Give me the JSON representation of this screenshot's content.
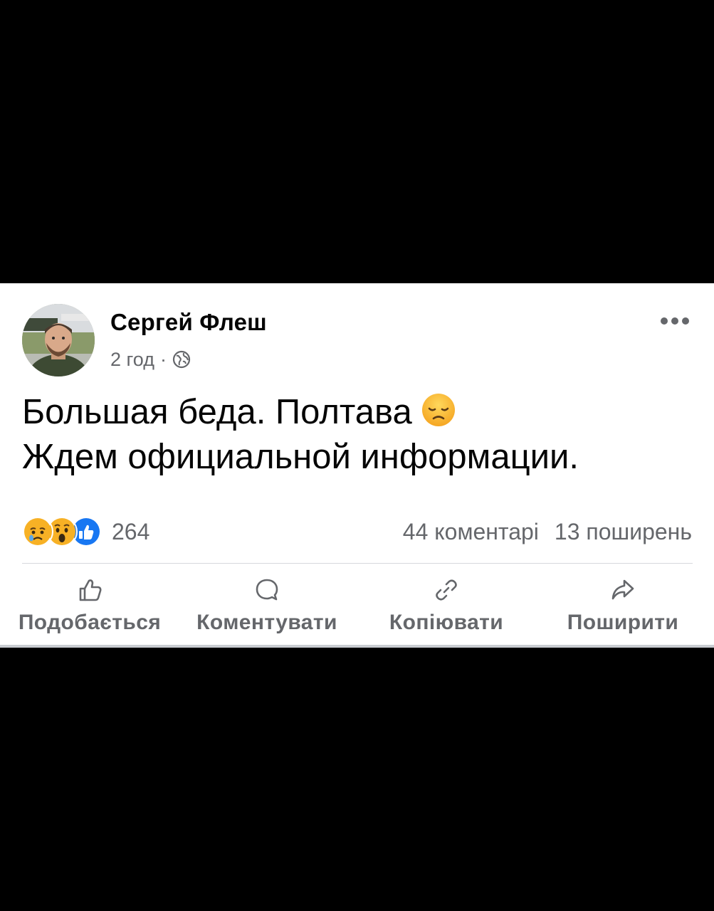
{
  "post": {
    "author_name": "Сергей Флеш",
    "timestamp": "2 год",
    "meta_separator": "·",
    "privacy_icon": "globe-icon",
    "more_icon": "more-options-icon",
    "text_line_1": "Большая беда. Полтава",
    "text_line_2": "Ждем официальной информации.",
    "inline_emoji": "disappointed-face-emoji"
  },
  "reactions": {
    "icons": [
      "sad-reaction-icon",
      "wow-reaction-icon",
      "like-reaction-icon"
    ],
    "count": "264"
  },
  "stats": {
    "comments": "44 коментарі",
    "shares": "13 поширень"
  },
  "actions": {
    "like_label": "Подобається",
    "comment_label": "Коментувати",
    "copy_label": "Копіювати",
    "share_label": "Поширити"
  },
  "colors": {
    "background": "#000000",
    "card": "#ffffff",
    "primary_text": "#050505",
    "secondary_text": "#65676b",
    "like_blue": "#1877f2",
    "reaction_yellow": "#f7b125"
  }
}
